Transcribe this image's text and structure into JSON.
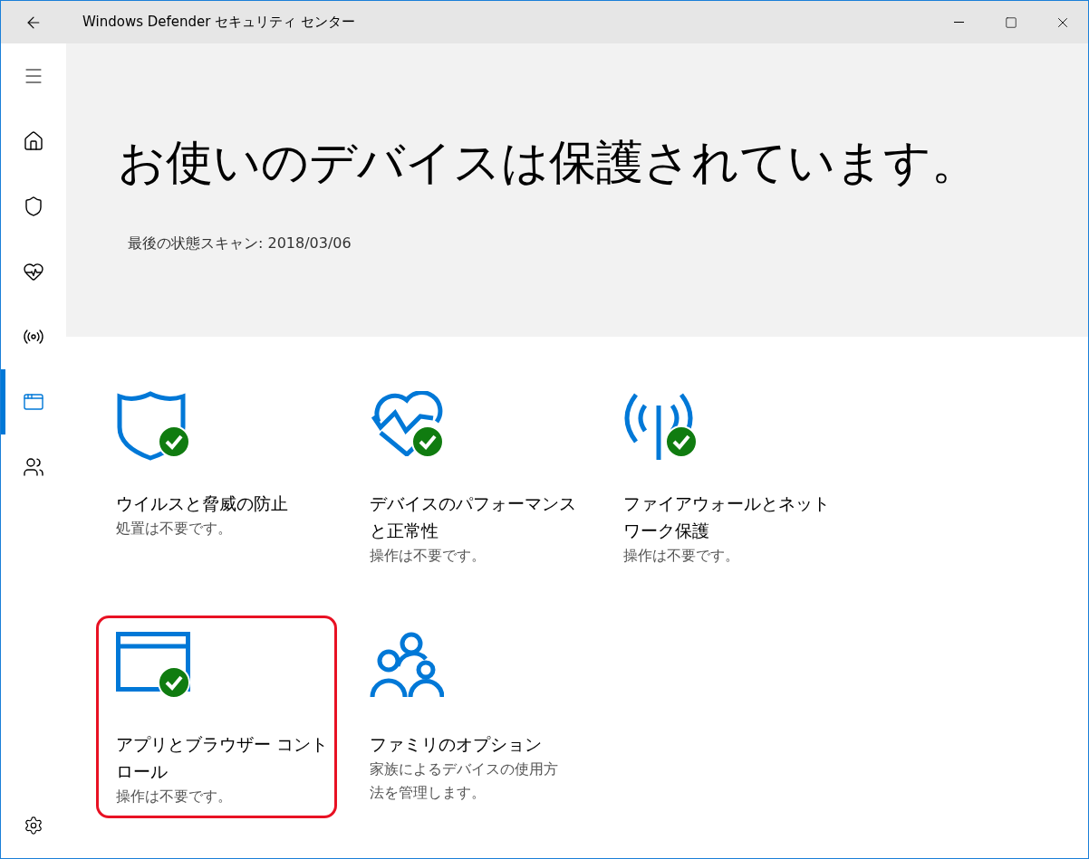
{
  "window": {
    "title": "Windows Defender セキュリティ センター"
  },
  "sidebar": {
    "items": [
      {
        "kind": "home",
        "selected": false
      },
      {
        "kind": "shield",
        "selected": false
      },
      {
        "kind": "heart",
        "selected": false
      },
      {
        "kind": "antenna",
        "selected": false
      },
      {
        "kind": "browser",
        "selected": true
      },
      {
        "kind": "family",
        "selected": false
      }
    ]
  },
  "hero": {
    "heading": "お使いのデバイスは保護されています。",
    "last_scan": "最後の状態スキャン:  2018/03/06"
  },
  "tiles": [
    {
      "kind": "shield",
      "title": "ウイルスと脅威の防止",
      "status": "処置は不要です。",
      "ok": true,
      "highlighted": false
    },
    {
      "kind": "heart",
      "title": "デバイスのパフォーマンスと正常性",
      "status": "操作は不要です。",
      "ok": true,
      "highlighted": false
    },
    {
      "kind": "antenna",
      "title": "ファイアウォールとネットワーク保護",
      "status": "操作は不要です。",
      "ok": true,
      "highlighted": false
    },
    {
      "kind": "browser",
      "title": "アプリとブラウザー コントロール",
      "status": "操作は不要です。",
      "ok": true,
      "highlighted": true
    },
    {
      "kind": "family",
      "title": "ファミリのオプション",
      "status": "家族によるデバイスの使用方法を管理します。",
      "ok": false,
      "highlighted": false
    }
  ]
}
